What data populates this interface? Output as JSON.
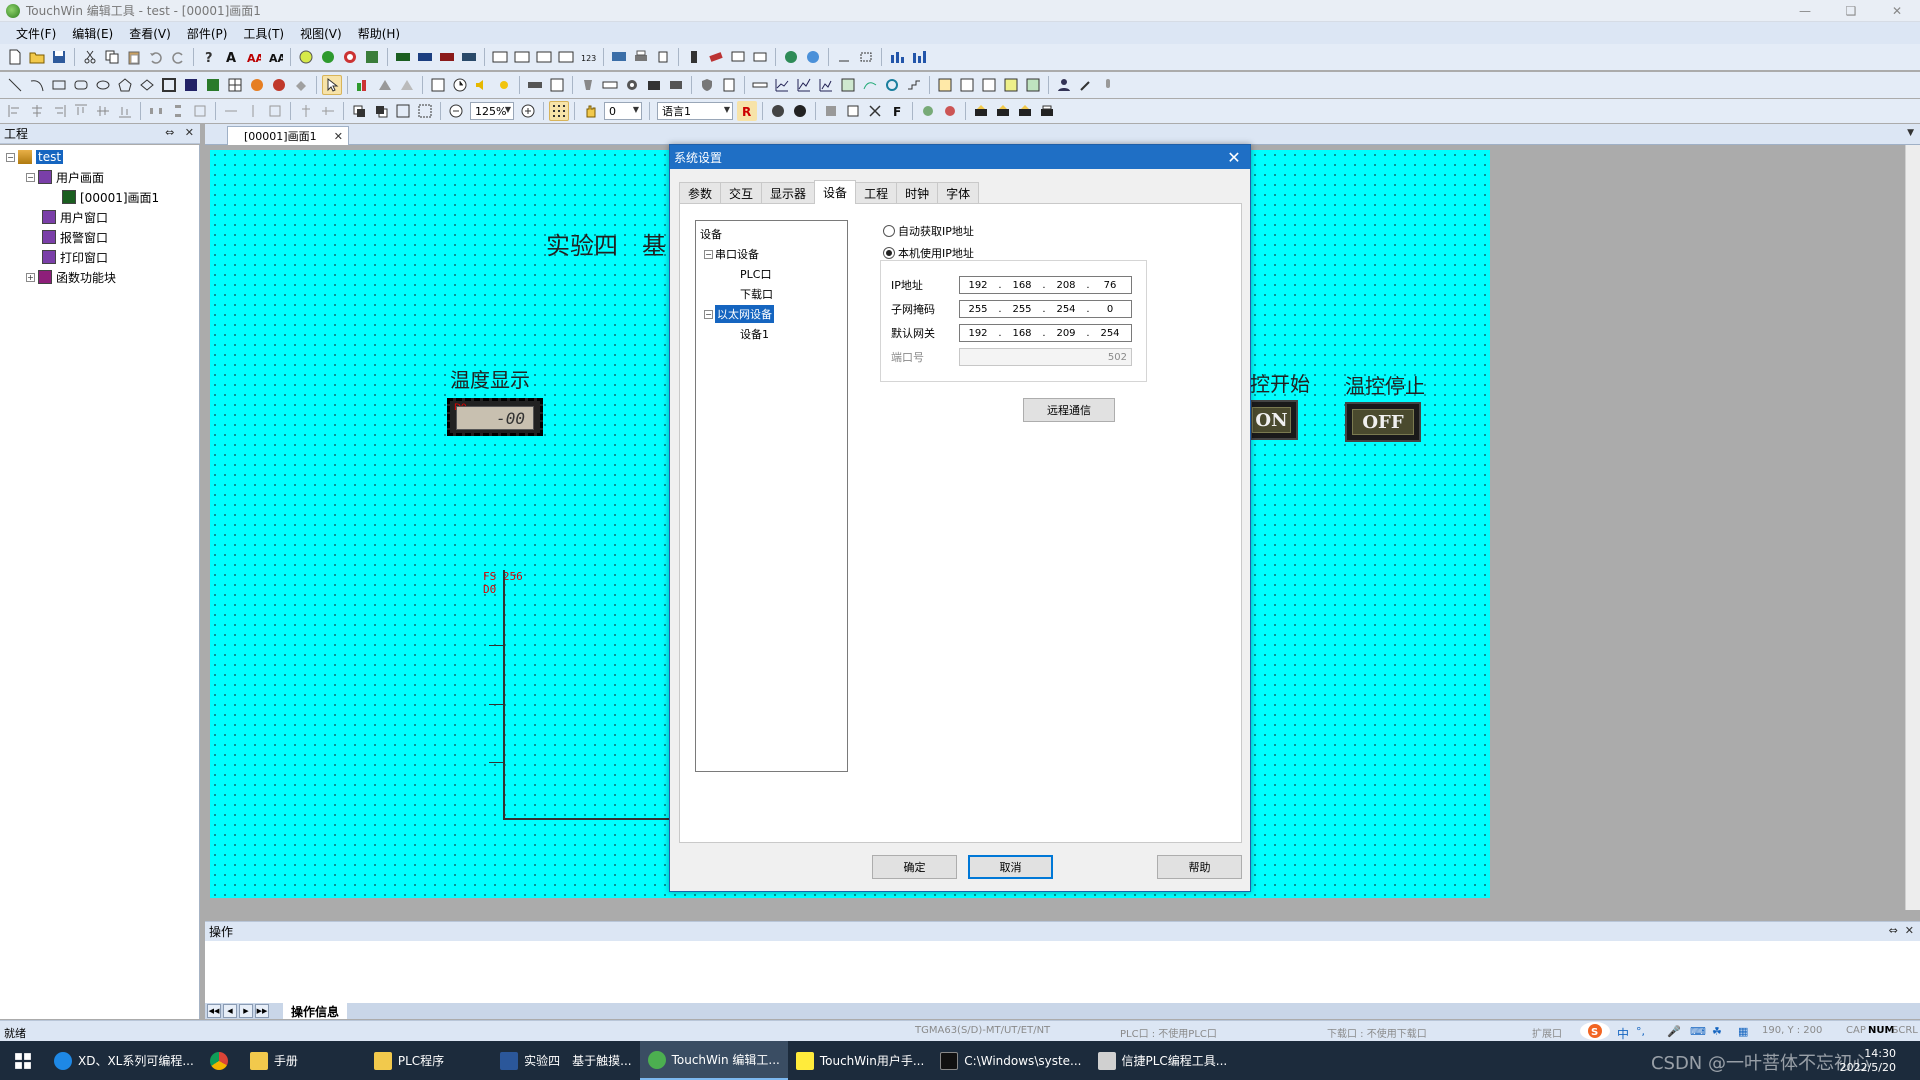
{
  "window": {
    "title": "TouchWin 编辑工具 - test - [00001]画面1"
  },
  "menu": [
    "文件(F)",
    "编辑(E)",
    "查看(V)",
    "部件(P)",
    "工具(T)",
    "视图(V)",
    "帮助(H)"
  ],
  "toolbar": {
    "zoom": "125%",
    "layer": "0",
    "language": "语言1"
  },
  "project": {
    "header": "工程",
    "root": "test",
    "nodes": {
      "user_screens": "用户画面",
      "screen1": "[00001]画面1",
      "user_windows": "用户窗口",
      "alarm_windows": "报警窗口",
      "print_windows": "打印窗口",
      "function_blocks": "函数功能块"
    }
  },
  "doc_tab": "[00001]画面1",
  "screen": {
    "title": "实验四　基",
    "temp_label": "温度显示",
    "temp_value": "-00",
    "temp_tag": "D0",
    "start_label": "控开始",
    "stop_label": "温控停止",
    "on_text": "ON",
    "off_text": "OFF",
    "trend_tag1": "FS 256",
    "trend_tag2": "D0"
  },
  "dialog": {
    "title": "系统设置",
    "tabs": [
      "参数",
      "交互",
      "显示器",
      "设备",
      "工程",
      "时钟",
      "字体"
    ],
    "active_tab": "设备",
    "tree": {
      "root": "设备",
      "serial": "串口设备",
      "plc_port": "PLC口",
      "download_port": "下载口",
      "ethernet": "以太网设备",
      "device1": "设备1"
    },
    "radio_auto": "自动获取IP地址",
    "radio_manual": "本机使用IP地址",
    "ip_label": "IP地址",
    "ip": [
      "192",
      "168",
      "208",
      "76"
    ],
    "mask_label": "子网掩码",
    "mask": [
      "255",
      "255",
      "254",
      "0"
    ],
    "gateway_label": "默认网关",
    "gateway": [
      "192",
      "168",
      "209",
      "254"
    ],
    "port_label": "端口号",
    "port": "502",
    "remote_btn": "远程通信",
    "ok_btn": "确定",
    "cancel_btn": "取消",
    "help_btn": "帮助"
  },
  "output": {
    "header": "操作",
    "tab": "操作信息"
  },
  "status": {
    "ready": "就绪",
    "model": "TGMA63(S/D)-MT/UT/ET/NT",
    "plc": "PLC口 : 不使用PLC口",
    "download": "下载口 : 不使用下载口",
    "ext": "扩展口",
    "coords": "190, Y : 200",
    "cap": "CAP",
    "num": "NUM",
    "scrl": "SCRL"
  },
  "taskbar": {
    "items": [
      "XD、XL系列可编程...",
      "手册",
      "PLC程序",
      "实验四　基于触摸...",
      "TouchWin 编辑工...",
      "TouchWin用户手...",
      "C:\\Windows\\syste...",
      "信捷PLC编程工具..."
    ],
    "ime": "中",
    "time": "14:30",
    "date": "2022/5/20",
    "watermark": "CSDN @一叶菩体不忘初心"
  },
  "colors": {
    "screen_bg": "#00FFFF",
    "dialog_title": "#1F6FC5",
    "selection": "#1565C0"
  }
}
